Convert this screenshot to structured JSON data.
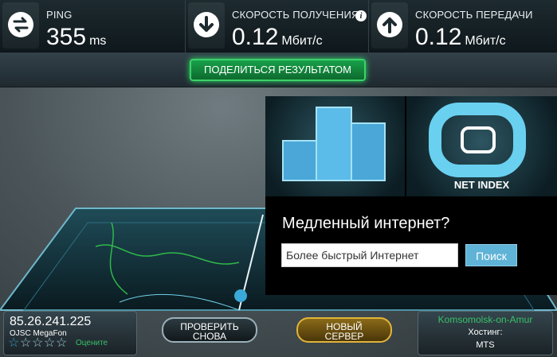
{
  "stats": {
    "ping": {
      "label": "PING",
      "value": "355",
      "unit": "ms",
      "icon": "swap-arrows-icon"
    },
    "download": {
      "label": "СКОРОСТЬ ПОЛУЧЕНИЯ",
      "value": "0.12",
      "unit": "Мбит/с",
      "icon": "download-arrow-icon",
      "info_icon": "i"
    },
    "upload": {
      "label": "СКОРОСТЬ ПЕРЕДАЧИ",
      "value": "0.12",
      "unit": "Мбит/с",
      "icon": "upload-arrow-icon"
    }
  },
  "share_button": "ПОДЕЛИТЬСЯ РЕЗУЛЬТАТОМ",
  "ad": {
    "netindex_label": "NET INDEX",
    "title": "Медленный интернет?",
    "search_value": "Более быстрый Интернет",
    "search_button": "Поиск"
  },
  "client": {
    "ip": "85.26.241.225",
    "isp": "OJSC MegaFon",
    "rate_label": "Оцените",
    "stars_total": 5,
    "stars_filled": 1
  },
  "buttons": {
    "retest_line1": "ПРОВЕРИТЬ",
    "retest_line2": "СНОВА",
    "newserver_line1": "НОВЫЙ",
    "newserver_line2": "СЕРВЕР"
  },
  "server": {
    "city": "Komsomolsk-on-Amur",
    "host_label": "Хостинг:",
    "host_name": "MTS"
  },
  "colors": {
    "accent_green": "#38c06a",
    "accent_blue": "#5fb3d6",
    "gold": "#e0b53a"
  }
}
